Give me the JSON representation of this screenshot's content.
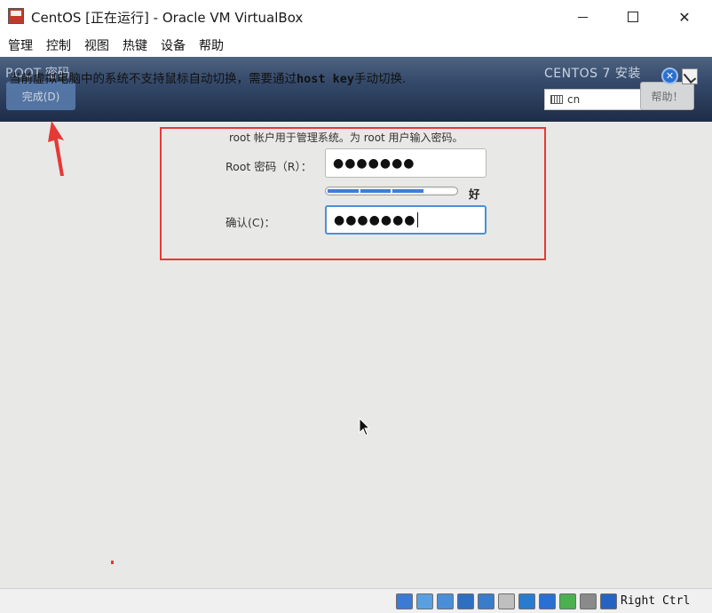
{
  "window": {
    "title": "CentOS [正在运行] - Oracle VM VirtualBox",
    "minimize_glyph": "",
    "close_glyph": "✕"
  },
  "menu": {
    "items": [
      "管理",
      "控制",
      "视图",
      "热键",
      "设备",
      "帮助"
    ]
  },
  "installer": {
    "header_title": "ROOT 密码",
    "done_button": "完成(D)",
    "product_label": "CENTOS 7 安装",
    "keyboard_layout": "cn",
    "help_button": "帮助！"
  },
  "notification": {
    "text_before": "当前虚拟电脑中的系统不支持鼠标自动切换，需要通过",
    "host_key": "host key",
    "text_after": "手动切换.",
    "close_glyph": "✕"
  },
  "form": {
    "caption": "root 帐户用于管理系统。为 root 用户输入密码。",
    "root_label": "Root 密码（R）：",
    "root_value": "●●●●●●●",
    "strength_text": "好",
    "strength_fraction": 0.75,
    "confirm_label": "确认(C)：",
    "confirm_value": "●●●●●●●"
  },
  "statusbar": {
    "host_key_label": "Right Ctrl",
    "icons": [
      {
        "name": "harddisk-icon",
        "color": "#3b7bd4"
      },
      {
        "name": "optical-disk-icon",
        "color": "#5aa0e0"
      },
      {
        "name": "audio-icon",
        "color": "#4a8fd6"
      },
      {
        "name": "network-icon",
        "color": "#2f6fbf"
      },
      {
        "name": "usb-icon",
        "color": "#3a7cc9"
      },
      {
        "name": "shared-folders-icon",
        "color": "#bfbfbf"
      },
      {
        "name": "display-icon",
        "color": "#2a7bd0"
      },
      {
        "name": "video-capture-icon",
        "color": "#2a6fd1"
      },
      {
        "name": "cpu-icon",
        "color": "#4caf50"
      },
      {
        "name": "mouse-integration-icon",
        "color": "#8a8a8a"
      },
      {
        "name": "keyboard-capture-icon",
        "color": "#2463c2"
      }
    ]
  }
}
